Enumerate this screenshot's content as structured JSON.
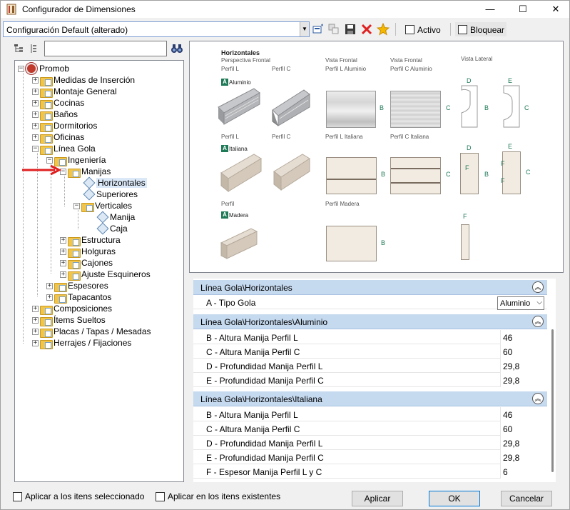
{
  "window": {
    "title": "Configurador de Dimensiones",
    "minimize": "—",
    "maximize": "☐",
    "close": "✕"
  },
  "toolbar": {
    "config_value": "Configuración Default (alterado)",
    "activo_label": "Activo",
    "bloquear_label": "Bloquear"
  },
  "search": {
    "value": "",
    "binoculars_icon": "binoculars-icon"
  },
  "tree": {
    "root": "Promob",
    "items": [
      "Medidas de Inserción",
      "Montaje General",
      "Cocinas",
      "Baños",
      "Dormitorios",
      "Oficinas",
      "Línea Gola",
      "Ingeniería",
      "Manijas",
      "Horizontales",
      "Superiores",
      "Verticales",
      "Manija",
      "Caja",
      "Estructura",
      "Holguras",
      "Cajones",
      "Ajuste Esquineros",
      "Espesores",
      "Tapacantos",
      "Composiciones",
      "Ítems Sueltos",
      "Placas / Tapas / Mesadas",
      "Herrajes / Fijaciones"
    ]
  },
  "preview": {
    "title": "Horizontales",
    "subtitle": "Perspectiva Frontal",
    "vista_frontal": "Vista Frontal",
    "vista_lateral": "Vista Lateral",
    "perfil_l": "Perfil L",
    "perfil_c": "Perfil C",
    "perfil_l_aluminio": "Perfil L Aluminio",
    "perfil_c_aluminio": "Perfil C Aluminio",
    "perfil_l_italiana": "Perfil L Italiana",
    "perfil_c_italiana": "Perfil C Italiana",
    "perfil": "Perfil",
    "perfil_madera": "Perfil Madera",
    "aluminio": "Aluminio",
    "italiana": "Italiana",
    "madera": "Madera",
    "badge_letter": "A",
    "dim_b": "B",
    "dim_c": "C",
    "dim_d": "D",
    "dim_e": "E",
    "dim_f": "F"
  },
  "properties": {
    "sections": [
      {
        "title": "Línea Gola\\Horizontales",
        "rows": [
          {
            "name": "A - Tipo Gola",
            "value": "Aluminio"
          }
        ]
      },
      {
        "title": "Línea Gola\\Horizontales\\Aluminio",
        "rows": [
          {
            "name": "B - Altura Manija Perfil L",
            "value": "46"
          },
          {
            "name": "C - Altura Manija Perfil C",
            "value": "60"
          },
          {
            "name": "D - Profundidad Manija Perfil L",
            "value": "29,8"
          },
          {
            "name": "E - Profundidad Manija Perfil C",
            "value": "29,8"
          }
        ]
      },
      {
        "title": "Línea Gola\\Horizontales\\Italiana",
        "rows": [
          {
            "name": "B - Altura Manija Perfil L",
            "value": "46"
          },
          {
            "name": "C - Altura Manija Perfil C",
            "value": "60"
          },
          {
            "name": "D - Profundidad Manija Perfil L",
            "value": "29,8"
          },
          {
            "name": "E - Profundidad Manija Perfil C",
            "value": "29,8"
          },
          {
            "name": "F - Espesor Manija Perfil L y C",
            "value": "6"
          }
        ]
      }
    ]
  },
  "footer": {
    "apply_selected": "Aplicar a los itens seleccionado",
    "apply_existing": "Aplicar en los itens existentes",
    "apply_button": "Aplicar",
    "ok_button": "OK",
    "cancel_button": "Cancelar"
  },
  "colors": {
    "section_header": "#c5d9ef",
    "dim_green": "#1f7a58",
    "selected": "#dbe8f7",
    "arrow_red": "#e02020"
  }
}
